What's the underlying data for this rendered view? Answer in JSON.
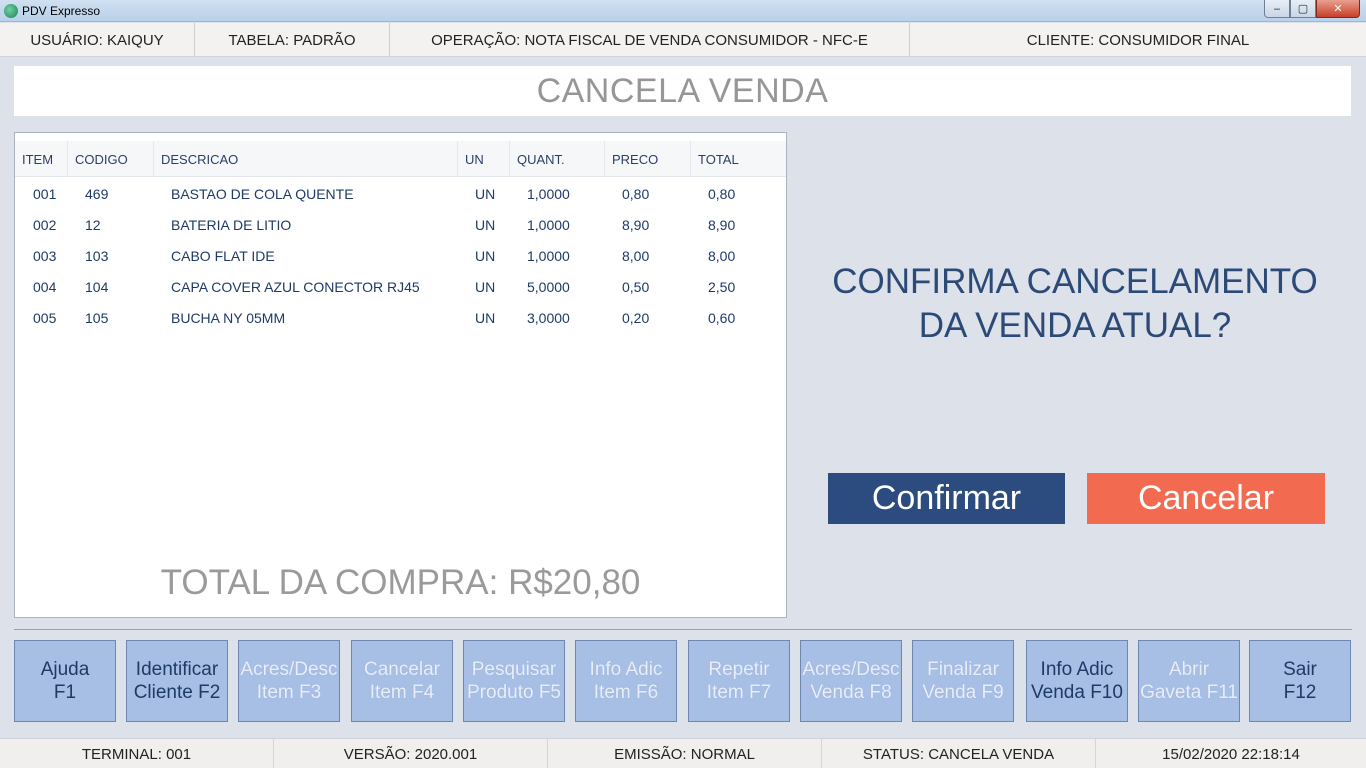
{
  "window": {
    "title": "PDV Expresso",
    "controls": {
      "minimize": "–",
      "maximize": "▢",
      "close": "✕"
    }
  },
  "infobar": {
    "usuario": "USUÁRIO: KAIQUY",
    "tabela": "TABELA: PADRÃO",
    "operacao": "OPERAÇÃO: NOTA FISCAL DE VENDA CONSUMIDOR - NFC-E",
    "cliente": "CLIENTE: CONSUMIDOR FINAL"
  },
  "header": {
    "title": "CANCELA VENDA"
  },
  "table": {
    "columns": [
      "ITEM",
      "CODIGO",
      "DESCRICAO",
      "UN",
      "QUANT.",
      "PRECO",
      "TOTAL"
    ],
    "rows": [
      [
        "001",
        "469",
        "BASTAO DE COLA QUENTE",
        "UN",
        "1,0000",
        "0,80",
        "0,80"
      ],
      [
        "002",
        "12",
        "BATERIA DE LITIO",
        "UN",
        "1,0000",
        "8,90",
        "8,90"
      ],
      [
        "003",
        "103",
        "CABO FLAT IDE",
        "UN",
        "1,0000",
        "8,00",
        "8,00"
      ],
      [
        "004",
        "104",
        "CAPA COVER AZUL CONECTOR RJ45",
        "UN",
        "5,0000",
        "0,50",
        "2,50"
      ],
      [
        "005",
        "105",
        "BUCHA NY 05MM",
        "UN",
        "3,0000",
        "0,20",
        "0,60"
      ]
    ],
    "total_label": "TOTAL DA COMPRA: R$20,80"
  },
  "confirm": {
    "question_line1": "CONFIRMA CANCELAMENTO",
    "question_line2": "DA VENDA ATUAL?",
    "confirm_label": "Confirmar",
    "cancel_label": "Cancelar"
  },
  "fkeys": [
    {
      "line1": "Ajuda",
      "line2": "F1",
      "enabled": true
    },
    {
      "line1": "Identificar",
      "line2": "Cliente F2",
      "enabled": true
    },
    {
      "line1": "Acres/Desc",
      "line2": "Item F3",
      "enabled": false
    },
    {
      "line1": "Cancelar",
      "line2": "Item F4",
      "enabled": false
    },
    {
      "line1": "Pesquisar",
      "line2": "Produto F5",
      "enabled": false
    },
    {
      "line1": "Info Adic",
      "line2": "Item F6",
      "enabled": false
    },
    {
      "line1": "Repetir",
      "line2": "Item F7",
      "enabled": false
    },
    {
      "line1": "Acres/Desc",
      "line2": "Venda F8",
      "enabled": false
    },
    {
      "line1": "Finalizar",
      "line2": "Venda F9",
      "enabled": false
    },
    {
      "line1": "Info Adic",
      "line2": "Venda F10",
      "enabled": true
    },
    {
      "line1": "Abrir",
      "line2": "Gaveta F11",
      "enabled": false
    },
    {
      "line1": "Sair",
      "line2": "F12",
      "enabled": true
    }
  ],
  "status": {
    "terminal": "TERMINAL: 001",
    "versao": "VERSÃO: 2020.001",
    "emissao": "EMISSÃO: NORMAL",
    "status": "STATUS: CANCELA VENDA",
    "datetime": "15/02/2020 22:18:14"
  },
  "colors": {
    "confirm_button": "#2c4c80",
    "cancel_button": "#f26a50",
    "fkey_background": "#a8bfe5",
    "text_primary": "#1e3a66"
  }
}
